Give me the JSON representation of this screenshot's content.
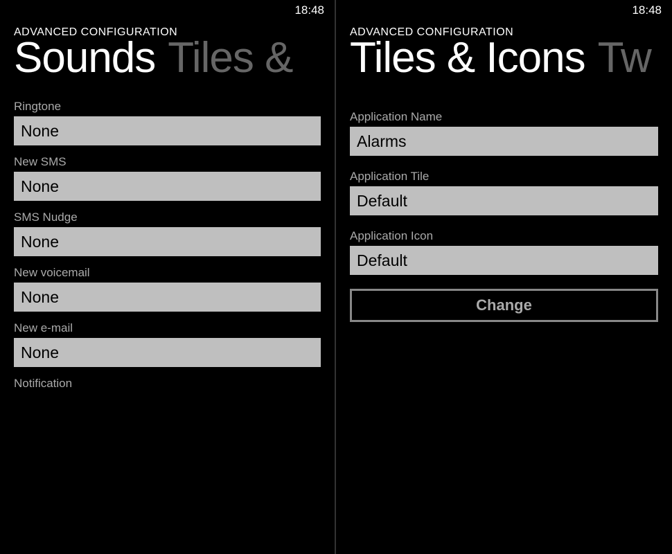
{
  "left": {
    "time": "18:48",
    "subtitle": "ADVANCED CONFIGURATION",
    "pivot_active": "Sounds",
    "pivot_next": "Tiles &",
    "fields": [
      {
        "label": "Ringtone",
        "value": "None"
      },
      {
        "label": "New SMS",
        "value": "None"
      },
      {
        "label": "SMS Nudge",
        "value": "None"
      },
      {
        "label": "New voicemail",
        "value": "None"
      },
      {
        "label": "New e-mail",
        "value": "None"
      }
    ],
    "trailing_label": "Notification"
  },
  "right": {
    "time": "18:48",
    "subtitle": "ADVANCED CONFIGURATION",
    "pivot_active": "Tiles & Icons",
    "pivot_next": "Tw",
    "fields": [
      {
        "label": "Application Name",
        "value": "Alarms"
      },
      {
        "label": "Application Tile",
        "value": "Default"
      },
      {
        "label": "Application Icon",
        "value": "Default"
      }
    ],
    "button": "Change"
  }
}
